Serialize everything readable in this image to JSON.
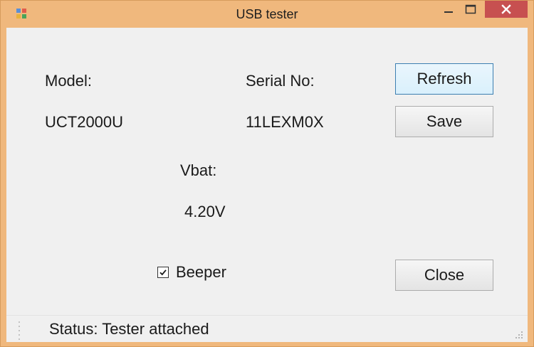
{
  "window": {
    "title": "USB tester",
    "controls": {
      "minimize": "minimize-icon",
      "maximize": "maximize-icon",
      "close": "close-icon"
    }
  },
  "labels": {
    "model": "Model:",
    "model_value": "UCT2000U",
    "serial": "Serial No:",
    "serial_value": "11LEXM0X",
    "vbat": "Vbat:",
    "vbat_value": "4.20V"
  },
  "buttons": {
    "refresh": "Refresh",
    "save": "Save",
    "close": "Close"
  },
  "beeper": {
    "label": "Beeper",
    "checked": true
  },
  "status": {
    "text": "Status: Tester attached"
  },
  "colors": {
    "title_bar": "#f0b87d",
    "close_button": "#c75050",
    "client_bg": "#f0f0f0",
    "focus_border": "#3c7fb1"
  }
}
